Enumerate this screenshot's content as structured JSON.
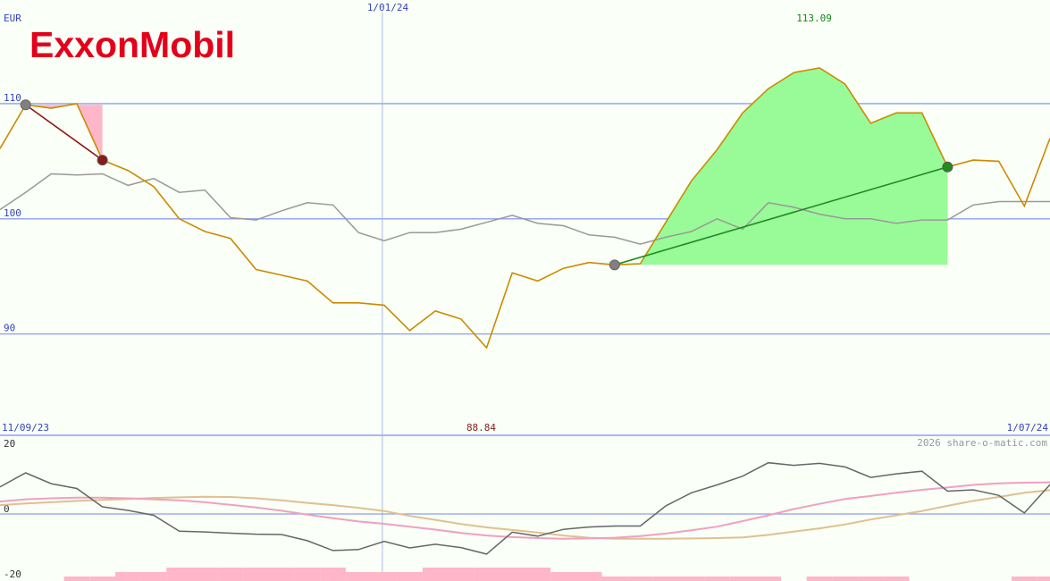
{
  "logo": {
    "text": "ExxonMobil",
    "color": "#e3001b"
  },
  "top_left_unit": "EUR",
  "colors": {
    "price": "#cc8a00",
    "benchmark": "#999999",
    "gain_fill": "#98fb98",
    "loss_fill": "#ffb6c8",
    "gain_line": "#228b22",
    "loss_line": "#8b1a1a",
    "grid": "#8c9ff0",
    "date_line": "#aabbdd",
    "osc_main": "#666666",
    "osc_pink": "#f0a0c0",
    "osc_tan": "#e0c090",
    "hist": "#ffb6c8",
    "label_blue": "#3344bb",
    "label_green": "#118811",
    "label_red": "#882222",
    "watermark": "#999999"
  },
  "chart_data": [
    {
      "type": "line",
      "ylim": [
        81.2,
        119.0
      ],
      "yticks": [
        90,
        100,
        110
      ],
      "ytick_labels": [
        "90",
        "100",
        "110"
      ],
      "date_marker": "1/01/24",
      "start_date_label": "11/09/23",
      "end_date_label": "1/07/24",
      "max_label": "113.09",
      "min_label": "88.84",
      "series": [
        {
          "key": "price",
          "values": [
            106.1,
            109.9,
            109.6,
            110.0,
            105.1,
            104.2,
            102.8,
            100.0,
            98.9,
            98.3,
            95.6,
            95.1,
            94.6,
            92.7,
            92.7,
            92.5,
            90.3,
            92.0,
            91.3,
            88.8,
            95.3,
            94.6,
            95.7,
            96.2,
            96.0,
            96.1,
            99.7,
            103.3,
            106.0,
            109.2,
            111.3,
            112.7,
            113.1,
            111.7,
            108.3,
            109.2,
            109.2,
            104.5,
            105.1,
            105.0,
            101.1,
            107.0
          ]
        },
        {
          "key": "benchmark",
          "values": [
            100.8,
            102.3,
            103.9,
            103.8,
            103.9,
            102.9,
            103.5,
            102.3,
            102.5,
            100.1,
            99.9,
            100.7,
            101.4,
            101.2,
            98.8,
            98.1,
            98.8,
            98.8,
            99.1,
            99.7,
            100.3,
            99.6,
            99.4,
            98.6,
            98.4,
            97.8,
            98.4,
            98.9,
            100.0,
            99.1,
            101.4,
            101.0,
            100.4,
            100.0,
            100.0,
            99.6,
            99.9,
            99.9,
            101.2,
            101.5,
            101.5,
            101.5
          ]
        }
      ],
      "trades": [
        {
          "from_index": 1,
          "to_index": 4,
          "from_value": 109.9,
          "to_value": 105.1,
          "result": "loss"
        },
        {
          "from_index": 24,
          "to_index": 37,
          "from_value": 96.0,
          "to_value": 104.5,
          "result": "gain"
        }
      ]
    },
    {
      "type": "line",
      "ylim": [
        -20,
        20
      ],
      "yticks": [
        -20,
        0,
        20
      ],
      "ytick_labels": [
        "-20",
        "0",
        "20"
      ],
      "series": [
        {
          "key": "osc_main",
          "values": [
            8.3,
            12.6,
            9.3,
            7.8,
            2.2,
            1.1,
            -0.4,
            -5.3,
            -5.5,
            -5.9,
            -6.2,
            -6.3,
            -8.2,
            -11.2,
            -10.9,
            -8.4,
            -10.4,
            -9.3,
            -10.3,
            -12.3,
            -5.6,
            -6.8,
            -4.7,
            -4.0,
            -3.7,
            -3.7,
            2.5,
            6.5,
            8.9,
            11.6,
            15.7,
            14.9,
            15.5,
            14.4,
            11.2,
            12.3,
            13.1,
            7.0,
            7.4,
            5.7,
            0.3,
            9.0
          ]
        },
        {
          "key": "osc_pink",
          "values": [
            3.8,
            4.5,
            4.8,
            5.0,
            5.0,
            4.8,
            4.5,
            4.2,
            3.6,
            2.8,
            2.0,
            1.0,
            -0.2,
            -1.3,
            -2.3,
            -3.0,
            -3.9,
            -4.8,
            -5.8,
            -6.6,
            -7.1,
            -7.4,
            -7.6,
            -7.5,
            -7.3,
            -6.8,
            -6.0,
            -5.0,
            -3.9,
            -2.2,
            -0.4,
            1.5,
            3.1,
            4.6,
            5.5,
            6.5,
            7.4,
            8.1,
            8.9,
            9.4,
            9.6,
            9.7
          ]
        },
        {
          "key": "osc_tan",
          "values": [
            2.7,
            3.2,
            3.6,
            4.0,
            4.3,
            4.6,
            4.9,
            5.1,
            5.3,
            5.2,
            4.8,
            4.2,
            3.4,
            2.7,
            1.9,
            0.9,
            -0.6,
            -1.8,
            -3.1,
            -4.1,
            -4.9,
            -5.7,
            -6.6,
            -7.3,
            -7.6,
            -7.6,
            -7.6,
            -7.5,
            -7.4,
            -7.2,
            -6.4,
            -5.4,
            -4.4,
            -3.2,
            -1.7,
            -0.4,
            0.9,
            2.5,
            4.0,
            5.2,
            6.5,
            7.3
          ]
        }
      ],
      "histogram_levels": [
        0,
        0,
        0,
        1,
        1,
        2,
        2,
        3,
        3,
        3,
        3,
        3,
        3,
        3,
        2,
        2,
        2,
        3,
        3,
        3,
        3,
        3,
        2,
        2,
        1,
        1,
        1,
        1,
        1,
        1,
        1,
        0,
        1,
        1,
        1,
        1,
        0,
        0,
        0,
        0,
        1,
        1
      ]
    }
  ],
  "watermark": "2026 share-o-matic.com"
}
